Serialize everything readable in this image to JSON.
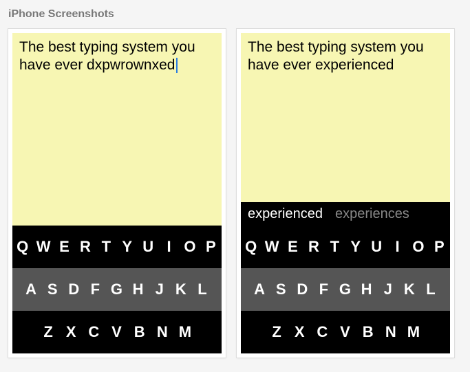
{
  "section_title": "iPhone Screenshots",
  "screenshots": [
    {
      "note_text": "The best typing system you have ever dxpwrownxed",
      "show_cursor": true,
      "suggestions": null
    },
    {
      "note_text": "The best typing system you have ever experienced",
      "show_cursor": false,
      "suggestions": {
        "primary": "experienced",
        "secondary": "experiences"
      }
    }
  ],
  "keyboard": {
    "row1": [
      "Q",
      "W",
      "E",
      "R",
      "T",
      "Y",
      "U",
      "I",
      "O",
      "P"
    ],
    "row2": [
      "A",
      "S",
      "D",
      "F",
      "G",
      "H",
      "J",
      "K",
      "L"
    ],
    "row3": [
      "Z",
      "X",
      "C",
      "V",
      "B",
      "N",
      "M"
    ]
  },
  "colors": {
    "note_bg": "#f7f6b3",
    "kb_black": "#000000",
    "kb_gray": "#555555",
    "cursor": "#2a7de1"
  }
}
